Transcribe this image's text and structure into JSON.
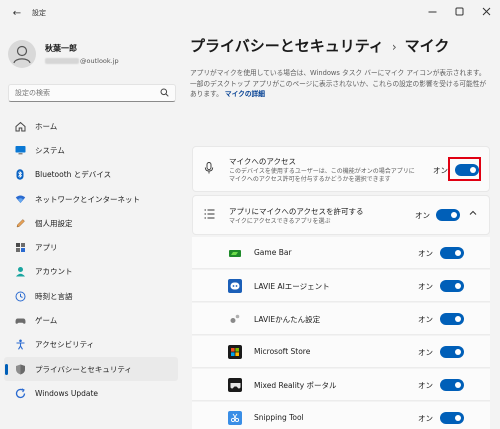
{
  "window": {
    "title": "設定",
    "back_icon": "arrow-left-icon",
    "controls": [
      "minimize-icon",
      "maximize-icon",
      "close-icon"
    ]
  },
  "profile": {
    "name": "秋葉一郎",
    "email_domain": "@outlook.jp"
  },
  "search": {
    "placeholder": "設定の検索",
    "icon": "search-icon"
  },
  "sidebar": {
    "items": [
      {
        "label": "ホーム",
        "icon": "home-icon"
      },
      {
        "label": "システム",
        "icon": "monitor-icon"
      },
      {
        "label": "Bluetooth とデバイス",
        "icon": "bluetooth-icon"
      },
      {
        "label": "ネットワークとインターネット",
        "icon": "wifi-icon"
      },
      {
        "label": "個人用設定",
        "icon": "pencil-icon"
      },
      {
        "label": "アプリ",
        "icon": "apps-icon"
      },
      {
        "label": "アカウント",
        "icon": "person-icon"
      },
      {
        "label": "時刻と言語",
        "icon": "globe-clock-icon"
      },
      {
        "label": "ゲーム",
        "icon": "gamepad-icon"
      },
      {
        "label": "アクセシビリティ",
        "icon": "accessibility-icon"
      },
      {
        "label": "プライバシーとセキュリティ",
        "icon": "shield-icon",
        "selected": true
      },
      {
        "label": "Windows Update",
        "icon": "update-icon"
      }
    ]
  },
  "main": {
    "breadcrumb_parent": "プライバシーとセキュリティ",
    "breadcrumb_separator": "›",
    "breadcrumb_current": "マイク",
    "description": "アプリがマイクを使用している場合は、Windows タスク バーにマイク アイコンが表示されます。一部のデスクトップ アプリがこのページに表示されないか、これらの設定の影響を受ける可能性があります。",
    "description_link": "マイクの詳細",
    "mic_access": {
      "title": "マイクへのアクセス",
      "subtitle": "このデバイスを使用するユーザーは、この機能がオンの場合アプリにマイクへのアクセス許可を付与するかどうかを選択できます",
      "state_label": "オン",
      "on": true,
      "icon": "microphone-icon"
    },
    "apps_access": {
      "title": "アプリにマイクへのアクセスを許可する",
      "subtitle": "マイクにアクセスできるアプリを選ぶ",
      "state_label": "オン",
      "on": true,
      "icon": "list-icon",
      "expand_icon": "chevron-up-icon"
    },
    "apps": [
      {
        "name": "Game Bar",
        "state_label": "オン",
        "on": true,
        "icon": "game-bar-icon"
      },
      {
        "name": "LAVIE AIエージェント",
        "state_label": "オン",
        "on": true,
        "icon": "lavie-ai-icon"
      },
      {
        "name": "LAVIEかんたん設定",
        "state_label": "オン",
        "on": true,
        "icon": "lavie-settings-icon"
      },
      {
        "name": "Microsoft Store",
        "state_label": "オン",
        "on": true,
        "icon": "store-icon"
      },
      {
        "name": "Mixed Reality ポータル",
        "state_label": "オン",
        "on": true,
        "icon": "mixed-reality-icon"
      },
      {
        "name": "Snipping Tool",
        "state_label": "オン",
        "on": true,
        "icon": "snipping-tool-icon"
      }
    ]
  },
  "colors": {
    "accent": "#005fb8",
    "highlight": "#e00012",
    "background": "#f3f3f3",
    "card": "#fbfbfb"
  }
}
